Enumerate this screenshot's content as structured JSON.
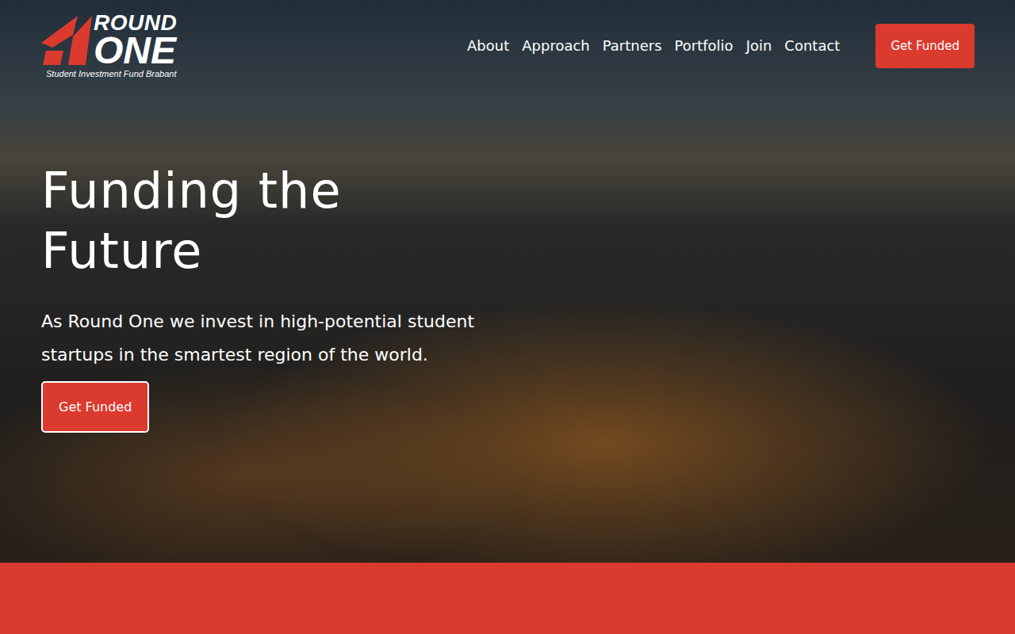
{
  "logo": {
    "line1": "ROUND",
    "line2": "ONE",
    "tagline": "Student Investment Fund Brabant"
  },
  "nav": [
    {
      "label": "About"
    },
    {
      "label": "Approach"
    },
    {
      "label": "Partners"
    },
    {
      "label": "Portfolio"
    },
    {
      "label": "Join"
    },
    {
      "label": "Contact"
    }
  ],
  "header_button": "Get Funded",
  "hero": {
    "title": "Funding the Future",
    "text": "As Round One we invest in high-potential student startups in the smartest region of the world.",
    "button": "Get Funded"
  }
}
